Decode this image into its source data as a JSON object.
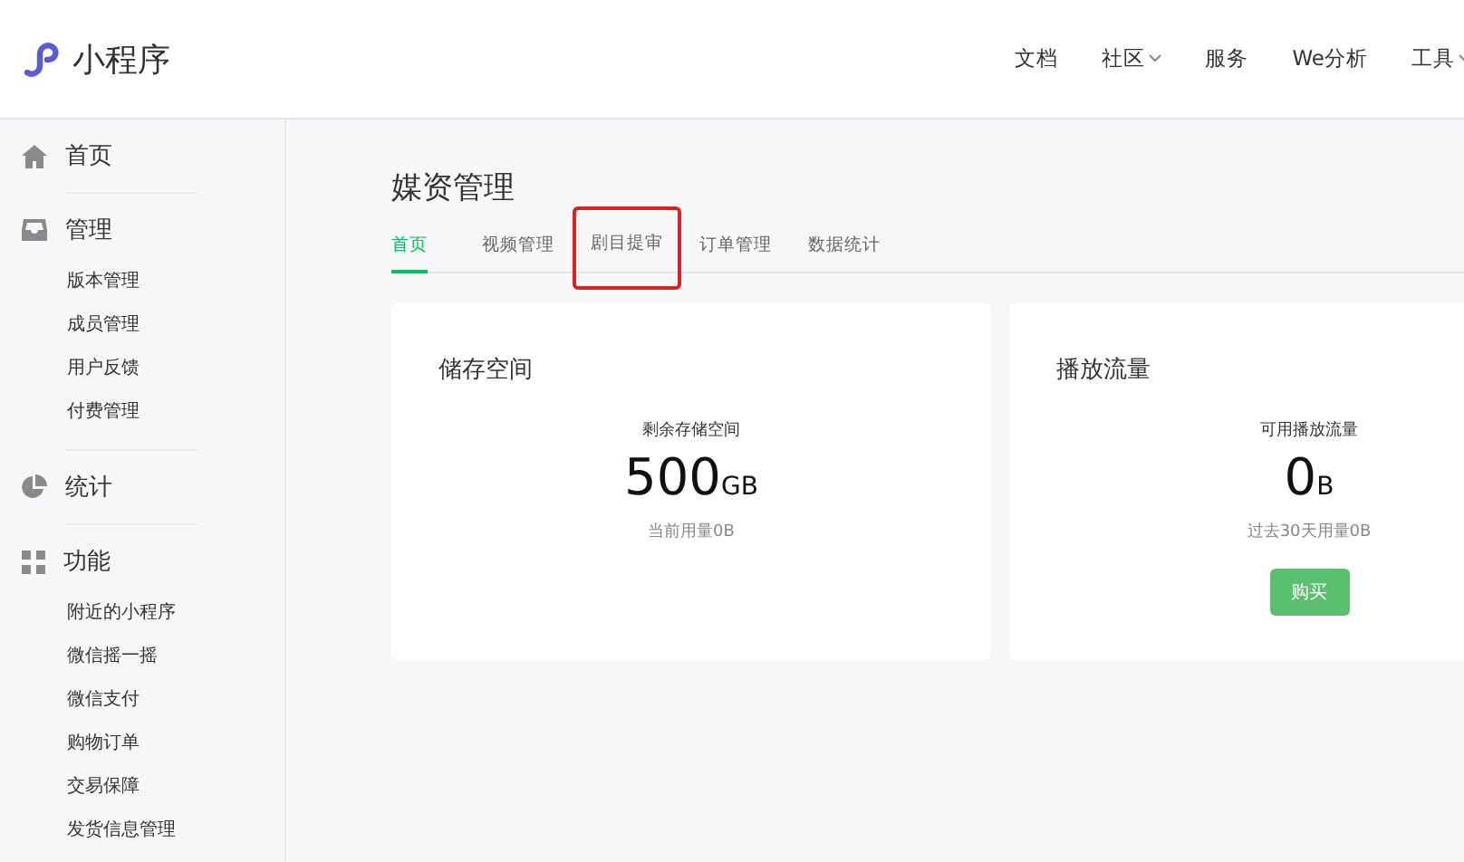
{
  "header": {
    "logo_text": "小程序",
    "nav": [
      {
        "label": "文档",
        "has_caret": false
      },
      {
        "label": "社区",
        "has_caret": true
      },
      {
        "label": "服务",
        "has_caret": false
      },
      {
        "label": "We分析",
        "has_caret": false
      },
      {
        "label": "工具",
        "has_caret": true
      }
    ]
  },
  "sidebar": {
    "sections": [
      {
        "label": "首页"
      },
      {
        "label": "管理",
        "items": [
          "版本管理",
          "成员管理",
          "用户反馈",
          "付费管理"
        ]
      },
      {
        "label": "统计"
      },
      {
        "label": "功能",
        "items": [
          "附近的小程序",
          "微信摇一摇",
          "微信支付",
          "购物订单",
          "交易保障",
          "发货信息管理"
        ]
      }
    ]
  },
  "page": {
    "title": "媒资管理",
    "tabs": [
      {
        "label": "首页",
        "selected": true,
        "highlighted": false
      },
      {
        "label": "视频管理",
        "selected": false,
        "highlighted": false
      },
      {
        "label": "剧目提审",
        "selected": false,
        "highlighted": true
      },
      {
        "label": "订单管理",
        "selected": false,
        "highlighted": false
      },
      {
        "label": "数据统计",
        "selected": false,
        "highlighted": false
      }
    ],
    "cards": [
      {
        "title": "储存空间",
        "caption": "剩余存储空间",
        "value": "500",
        "unit": "GB",
        "note": "当前用量0B"
      },
      {
        "title": "播放流量",
        "caption": "可用播放流量",
        "value": "0",
        "unit": "B",
        "note": "过去30天用量0B",
        "button": "购买"
      }
    ]
  }
}
